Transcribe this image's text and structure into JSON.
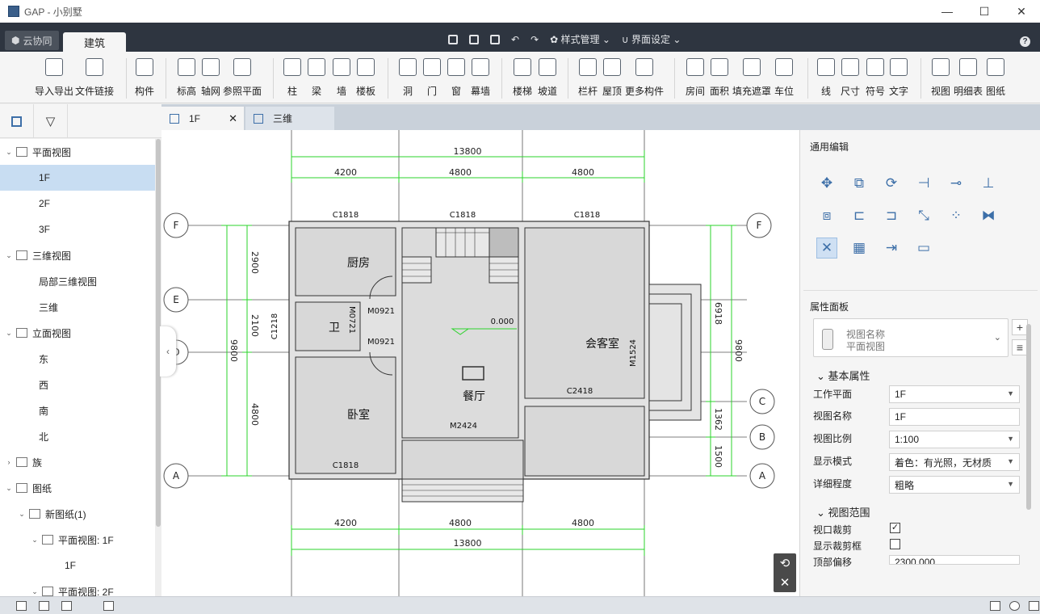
{
  "window": {
    "title": "GAP - 小别墅"
  },
  "tabs": {
    "cloud": "云协同",
    "architecture": "建筑"
  },
  "quick": {
    "style_mgmt": "样式管理",
    "ui_settings": "界面设定"
  },
  "ribbon": [
    {
      "label": "导入导出",
      "icon": "cad-import-icon"
    },
    {
      "label": "文件链接",
      "icon": "file-link-icon"
    },
    {
      "label": "构件",
      "icon": "component-icon"
    },
    {
      "label": "标高",
      "icon": "level-icon"
    },
    {
      "label": "轴网",
      "icon": "grid-icon"
    },
    {
      "label": "参照平面",
      "icon": "ref-plane-icon"
    },
    {
      "label": "柱",
      "icon": "column-icon"
    },
    {
      "label": "梁",
      "icon": "beam-icon"
    },
    {
      "label": "墙",
      "icon": "wall-icon"
    },
    {
      "label": "楼板",
      "icon": "floor-icon"
    },
    {
      "label": "洞",
      "icon": "opening-icon"
    },
    {
      "label": "门",
      "icon": "door-icon"
    },
    {
      "label": "窗",
      "icon": "window-icon"
    },
    {
      "label": "幕墙",
      "icon": "curtain-wall-icon"
    },
    {
      "label": "楼梯",
      "icon": "stair-icon"
    },
    {
      "label": "坡道",
      "icon": "ramp-icon"
    },
    {
      "label": "栏杆",
      "icon": "railing-icon"
    },
    {
      "label": "屋顶",
      "icon": "roof-icon"
    },
    {
      "label": "更多构件",
      "icon": "more-components-icon"
    },
    {
      "label": "房间",
      "icon": "room-icon"
    },
    {
      "label": "面积",
      "icon": "area-icon"
    },
    {
      "label": "填充遮罩",
      "icon": "fill-mask-icon"
    },
    {
      "label": "车位",
      "icon": "parking-icon"
    },
    {
      "label": "线",
      "icon": "line-icon"
    },
    {
      "label": "尺寸",
      "icon": "dimension-icon"
    },
    {
      "label": "符号",
      "icon": "symbol-icon"
    },
    {
      "label": "文字",
      "icon": "text-icon"
    },
    {
      "label": "视图",
      "icon": "view-icon"
    },
    {
      "label": "明细表",
      "icon": "schedule-icon"
    },
    {
      "label": "图纸",
      "icon": "sheet-icon"
    }
  ],
  "tree": [
    {
      "label": "平面视图",
      "arrow": "v"
    },
    {
      "label": "1F"
    },
    {
      "label": "2F"
    },
    {
      "label": "3F"
    },
    {
      "label": "三维视图",
      "arrow": "v"
    },
    {
      "label": "局部三维视图"
    },
    {
      "label": "三维"
    },
    {
      "label": "立面视图",
      "arrow": "v"
    },
    {
      "label": "东"
    },
    {
      "label": "西"
    },
    {
      "label": "南"
    },
    {
      "label": "北"
    },
    {
      "label": "族",
      "arrow": ">"
    },
    {
      "label": "图纸",
      "arrow": "v"
    },
    {
      "label": "新图纸(1)",
      "arrow": "v"
    },
    {
      "label": "平面视图: 1F",
      "arrow": "v"
    },
    {
      "label": "1F"
    },
    {
      "label": "平面视图: 2F",
      "arrow": "v"
    }
  ],
  "doc_tabs": {
    "tab1": "1F",
    "tab2": "三维"
  },
  "drawing": {
    "dims_top": {
      "total": "13800",
      "a": "4200",
      "b": "4800",
      "c": "4800"
    },
    "dims_bottom": {
      "total": "13800",
      "a": "4200",
      "b": "4800",
      "c": "4800"
    },
    "dims_left": {
      "total": "9800",
      "a": "2900",
      "b": "2100",
      "c": "4800"
    },
    "dims_right": {
      "total": "9800",
      "a": "6918",
      "b": "1362",
      "c": "1500"
    },
    "axes": [
      "F",
      "E",
      "D",
      "C",
      "B",
      "A"
    ],
    "rooms": {
      "kitchen": "厨房",
      "wc": "卫",
      "living": "会客室",
      "dining": "餐厅",
      "bedroom": "卧室"
    },
    "tags": {
      "c1818a": "C1818",
      "c1818b": "C1818",
      "c1818c": "C1818",
      "c1818d": "C1818",
      "c1218": "C1218",
      "m0921a": "M0921",
      "m0921b": "M0921",
      "m0721": "M0721",
      "m1524": "M1524",
      "c2418": "C2418",
      "m2424": "M2424",
      "level": "0.000"
    }
  },
  "panel": {
    "general_edit": "通用编辑",
    "prop_panel": "属性面板",
    "view_name_hint": "视图名称",
    "view_type": "平面视图",
    "basic_props": "基本属性",
    "work_plane": {
      "label": "工作平面",
      "value": "1F"
    },
    "view_name": {
      "label": "视图名称",
      "value": "1F"
    },
    "scale": {
      "label": "视图比例",
      "value": "1:100"
    },
    "display_mode": {
      "label": "显示模式",
      "value": "着色：有光照，无材质"
    },
    "detail": {
      "label": "详细程度",
      "value": "粗略"
    },
    "view_range": "视图范围",
    "crop": {
      "label": "视口裁剪",
      "checked": "✓"
    },
    "show_crop": {
      "label": "显示裁剪框"
    },
    "top_offset": {
      "label": "顶部偏移",
      "value": "2300.000"
    }
  }
}
